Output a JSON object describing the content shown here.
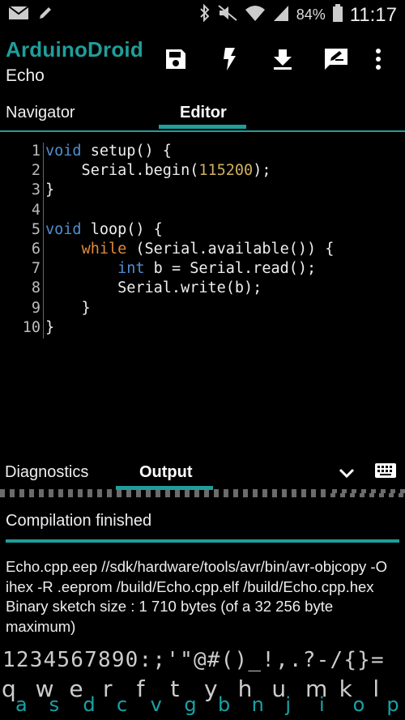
{
  "status_bar": {
    "battery": "84%",
    "time": "11:17",
    "icons_left": [
      "mail-icon",
      "pencil-icon"
    ],
    "icons_right": [
      "bluetooth-icon",
      "mute-icon",
      "wifi-icon",
      "signal-icon",
      "battery-icon"
    ]
  },
  "app_bar": {
    "title": "ArduinoDroid",
    "subtitle": "Echo",
    "actions": [
      "save-icon",
      "flash-icon",
      "download-icon",
      "edit-icon",
      "more-icon"
    ]
  },
  "tabs": [
    {
      "label": "Navigator",
      "active": false
    },
    {
      "label": "Editor",
      "active": true
    }
  ],
  "editor": {
    "line_numbers": [
      "1",
      "2",
      "3",
      "4",
      "5",
      "6",
      "7",
      "8",
      "9",
      "10"
    ],
    "lines": [
      [
        {
          "t": "void",
          "c": "kw3"
        },
        {
          "t": " setup() {",
          "c": ""
        }
      ],
      [
        {
          "t": "    Serial.begin(",
          "c": ""
        },
        {
          "t": "115200",
          "c": "num"
        },
        {
          "t": ");",
          "c": ""
        }
      ],
      [
        {
          "t": "}",
          "c": ""
        }
      ],
      [
        {
          "t": "",
          "c": ""
        }
      ],
      [
        {
          "t": "void",
          "c": "kw3"
        },
        {
          "t": " loop() {",
          "c": ""
        }
      ],
      [
        {
          "t": "    ",
          "c": ""
        },
        {
          "t": "while",
          "c": "kw2"
        },
        {
          "t": " (Serial.available()) {",
          "c": ""
        }
      ],
      [
        {
          "t": "        ",
          "c": ""
        },
        {
          "t": "int",
          "c": "kw3"
        },
        {
          "t": " b = Serial.read();",
          "c": ""
        }
      ],
      [
        {
          "t": "        Serial.write(b);",
          "c": ""
        }
      ],
      [
        {
          "t": "    }",
          "c": ""
        }
      ],
      [
        {
          "t": "}",
          "c": ""
        }
      ]
    ]
  },
  "bottom_panel": {
    "tabs": [
      {
        "label": "Diagnostics",
        "active": false
      },
      {
        "label": "Output",
        "active": true
      }
    ],
    "collapse_icon": "chevron-down-icon",
    "keyboard_icon": "keyboard-icon",
    "status": "Compilation finished",
    "output": "Echo.cpp.eep //sdk/hardware/tools/avr/bin/avr-objcopy -O ihex -R .eeprom /build/Echo.cpp.elf /build/Echo.cpp.hex Binary sketch size : 1 710 bytes (of a 32 256 byte maximum)"
  },
  "keyboard": {
    "symbols": "1234567890:;'\"@#()_!,.?-/{}=",
    "keys": [
      {
        "main": "q",
        "alt": "a"
      },
      {
        "main": "w",
        "alt": "s"
      },
      {
        "main": "e",
        "alt": "d"
      },
      {
        "main": "r",
        "alt": "c"
      },
      {
        "main": "f",
        "alt": "v"
      },
      {
        "main": "t",
        "alt": "g"
      },
      {
        "main": "y",
        "alt": "b"
      },
      {
        "main": "h",
        "alt": "n"
      },
      {
        "main": "u",
        "alt": "j"
      },
      {
        "main": "m",
        "alt": "i"
      },
      {
        "main": "k",
        "alt": "o"
      },
      {
        "main": "l",
        "alt": "p"
      }
    ]
  },
  "colors": {
    "accent": "#1f9e9a",
    "keyword_blue": "#4f8fd0",
    "keyword_orange": "#e08a3a",
    "number": "#d0b060"
  }
}
